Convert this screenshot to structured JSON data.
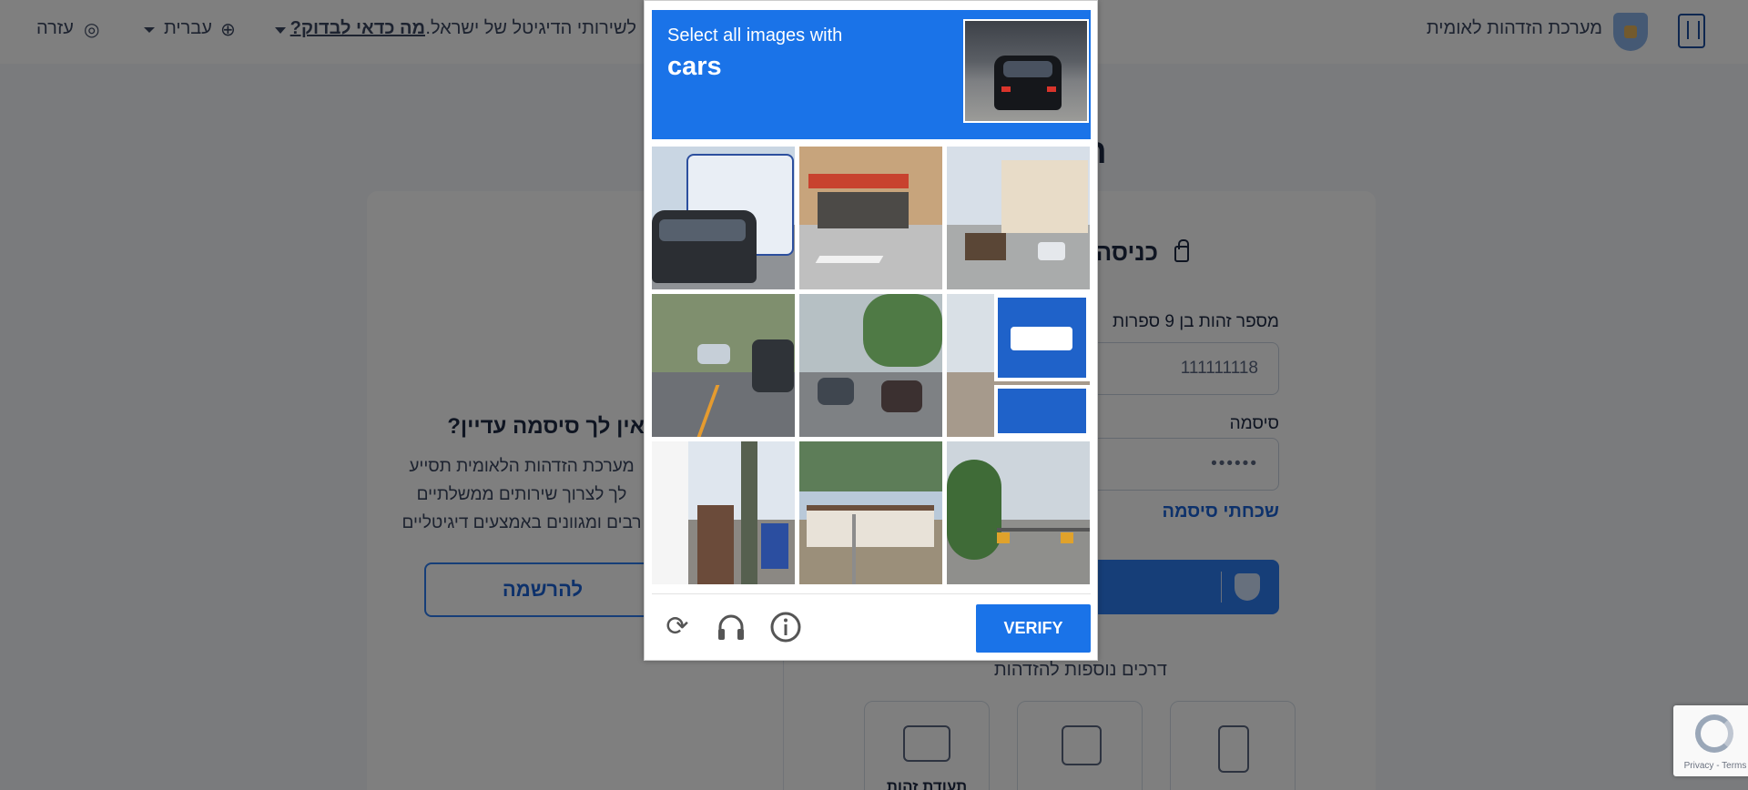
{
  "header": {
    "brand_title": "מערכת הזדהות לאומית",
    "tagline": "לשירותי הדיגיטל של ישראל.",
    "worth_checking_link": "מה כדאי לבדוק?",
    "language": "עברית",
    "help": "עזרה"
  },
  "page": {
    "heading_fragment": "ה"
  },
  "login": {
    "title": "כניסה",
    "id_label": "מספר זהות בן 9 ספרות",
    "id_value": "111111118",
    "password_label": "סיסמה",
    "password_value": "••••••",
    "forgot_password": "שכחתי סיסמה",
    "more_ways": "דרכים נוספות להזדהות",
    "methods": [
      {
        "label": ""
      },
      {
        "label": ""
      },
      {
        "label": "תעודת זהות"
      }
    ]
  },
  "register": {
    "title": "אין לך סיסמה עדיין?",
    "description": "מערכת הזדהות הלאומית תסייע לך לצרוך שירותים ממשלתיים רבים ומגוונים באמצעים דיגיטליים",
    "button": "להרשמה"
  },
  "captcha": {
    "prompt": "Select all images with",
    "target": "cars",
    "verify_label": "VERIFY",
    "icons": {
      "reload": "reload-icon",
      "audio": "headphones-icon",
      "info": "info-icon"
    },
    "tiles": [
      {
        "scene": "bus-and-suv"
      },
      {
        "scene": "storefront-street"
      },
      {
        "scene": "intersection-building"
      },
      {
        "scene": "road-with-cars"
      },
      {
        "scene": "street-trees-car"
      },
      {
        "scene": "bus-stop-sign"
      },
      {
        "scene": "pole-and-buildings"
      },
      {
        "scene": "station-building"
      },
      {
        "scene": "traffic-lights-trees"
      }
    ]
  },
  "recaptcha_badge": {
    "text": "Privacy - Terms"
  }
}
